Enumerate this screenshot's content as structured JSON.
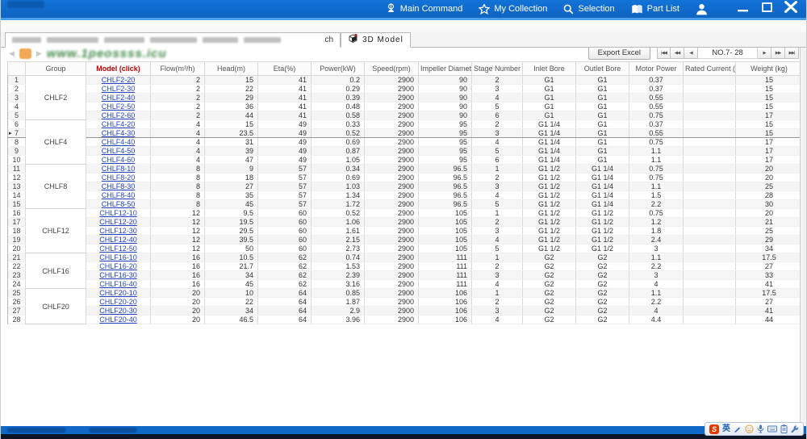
{
  "titlebar": {
    "menu": [
      {
        "label": "Main Command"
      },
      {
        "label": "My Collection"
      },
      {
        "label": "Selection"
      },
      {
        "label": "Part List"
      }
    ]
  },
  "tabs": {
    "redacted_tab_fragment": "ch",
    "model_tab_label": "3D Model"
  },
  "watermark": {
    "text": "www.1peossss.icu"
  },
  "toolbar": {
    "export_label": "Export Excel",
    "pager_prev": [
      "|◀◀",
      "◀◀",
      "◀"
    ],
    "page_label": "NO.7- 28",
    "pager_next": [
      "▶",
      "▶▶",
      "▶▶|"
    ]
  },
  "colors": {
    "titlebar_blue": "#0f67c6",
    "accent_blue": "#4d9ee9",
    "link_blue": "#2946c0",
    "model_header_red": "#c00000",
    "watermark_green": "#37813c",
    "ime_logo_red": "#e23b00"
  },
  "ime": {
    "logo": "S",
    "lang": "英",
    "icons": [
      "pen-icon",
      "smiley-icon",
      "mic-icon",
      "keyboard-icon",
      "clipboard-icon",
      "wrench-icon"
    ]
  },
  "table": {
    "headers": [
      "",
      "Group",
      "Model (click)",
      "Flow(m³/h)",
      "Head(m)",
      "Eta(%)",
      "Power(kW)",
      "Speed(rpm)",
      "Impeller Diameter",
      "Stage Number",
      "Inlet Bore",
      "Outlet Bore",
      "Motor Power",
      "Rated Current (A)",
      "Weight (kg)"
    ],
    "selected_row": 7,
    "groups": [
      {
        "name": "CHLF2",
        "rows": 5
      },
      {
        "name": "CHLF4",
        "rows": 5
      },
      {
        "name": "CHLF8",
        "rows": 5
      },
      {
        "name": "CHLF12",
        "rows": 5
      },
      {
        "name": "CHLF16",
        "rows": 4
      },
      {
        "name": "CHLF20",
        "rows": 4
      }
    ],
    "rows": [
      {
        "no": 1,
        "model": "CHLF2-20",
        "flow": 2,
        "head": 15,
        "eta": 41,
        "power": 0.2,
        "speed": 2900,
        "impeller": 90,
        "stage": 2,
        "inlet": "G1",
        "outlet": "G1",
        "motor": 0.37,
        "rated": "",
        "weight": 15
      },
      {
        "no": 2,
        "model": "CHLF2-30",
        "flow": 2,
        "head": 22,
        "eta": 41,
        "power": 0.29,
        "speed": 2900,
        "impeller": 90,
        "stage": 3,
        "inlet": "G1",
        "outlet": "G1",
        "motor": 0.37,
        "rated": "",
        "weight": 15
      },
      {
        "no": 3,
        "model": "CHLF2-40",
        "flow": 2,
        "head": 29,
        "eta": 41,
        "power": 0.39,
        "speed": 2900,
        "impeller": 90,
        "stage": 4,
        "inlet": "G1",
        "outlet": "G1",
        "motor": 0.55,
        "rated": "",
        "weight": 15
      },
      {
        "no": 4,
        "model": "CHLF2-50",
        "flow": 2,
        "head": 36,
        "eta": 41,
        "power": 0.48,
        "speed": 2900,
        "impeller": 90,
        "stage": 5,
        "inlet": "G1",
        "outlet": "G1",
        "motor": 0.55,
        "rated": "",
        "weight": 15
      },
      {
        "no": 5,
        "model": "CHLF2-60",
        "flow": 2,
        "head": 44,
        "eta": 41,
        "power": 0.58,
        "speed": 2900,
        "impeller": 90,
        "stage": 6,
        "inlet": "G1",
        "outlet": "G1",
        "motor": 0.75,
        "rated": "",
        "weight": 17
      },
      {
        "no": 6,
        "model": "CHLF4-20",
        "flow": 4,
        "head": 15,
        "eta": 49,
        "power": 0.33,
        "speed": 2900,
        "impeller": 95,
        "stage": 2,
        "inlet": "G1 1/4",
        "outlet": "G1",
        "motor": 0.37,
        "rated": "",
        "weight": 15
      },
      {
        "no": 7,
        "model": "CHLF4-30",
        "flow": 4,
        "head": 23.5,
        "eta": 49,
        "power": 0.52,
        "speed": 2900,
        "impeller": 95,
        "stage": 3,
        "inlet": "G1 1/4",
        "outlet": "G1",
        "motor": 0.55,
        "rated": "",
        "weight": 15
      },
      {
        "no": 8,
        "model": "CHLF4-40",
        "flow": 4,
        "head": 31,
        "eta": 49,
        "power": 0.69,
        "speed": 2900,
        "impeller": 95,
        "stage": 4,
        "inlet": "G1 1/4",
        "outlet": "G1",
        "motor": 0.75,
        "rated": "",
        "weight": 17
      },
      {
        "no": 9,
        "model": "CHLF4-50",
        "flow": 4,
        "head": 39,
        "eta": 49,
        "power": 0.87,
        "speed": 2900,
        "impeller": 95,
        "stage": 5,
        "inlet": "G1 1/4",
        "outlet": "G1",
        "motor": 1.1,
        "rated": "",
        "weight": 17
      },
      {
        "no": 10,
        "model": "CHLF4-60",
        "flow": 4,
        "head": 47,
        "eta": 49,
        "power": 1.05,
        "speed": 2900,
        "impeller": 95,
        "stage": 6,
        "inlet": "G1 1/4",
        "outlet": "G1",
        "motor": 1.1,
        "rated": "",
        "weight": 17
      },
      {
        "no": 11,
        "model": "CHLF8-10",
        "flow": 8,
        "head": 9,
        "eta": 57,
        "power": 0.34,
        "speed": 2900,
        "impeller": 96.5,
        "stage": 1,
        "inlet": "G1 1/2",
        "outlet": "G1 1/4",
        "motor": 0.75,
        "rated": "",
        "weight": 20
      },
      {
        "no": 12,
        "model": "CHLF8-20",
        "flow": 8,
        "head": 18,
        "eta": 57,
        "power": 0.69,
        "speed": 2900,
        "impeller": 96.5,
        "stage": 2,
        "inlet": "G1 1/2",
        "outlet": "G1 1/4",
        "motor": 0.75,
        "rated": "",
        "weight": 20
      },
      {
        "no": 13,
        "model": "CHLF8-30",
        "flow": 8,
        "head": 27,
        "eta": 57,
        "power": 1.03,
        "speed": 2900,
        "impeller": 96.5,
        "stage": 3,
        "inlet": "G1 1/2",
        "outlet": "G1 1/4",
        "motor": 1.1,
        "rated": "",
        "weight": 25
      },
      {
        "no": 14,
        "model": "CHLF8-40",
        "flow": 8,
        "head": 35,
        "eta": 57,
        "power": 1.34,
        "speed": 2900,
        "impeller": 96.5,
        "stage": 4,
        "inlet": "G1 1/2",
        "outlet": "G1 1/4",
        "motor": 1.5,
        "rated": "",
        "weight": 28
      },
      {
        "no": 15,
        "model": "CHLF8-50",
        "flow": 8,
        "head": 45,
        "eta": 57,
        "power": 1.72,
        "speed": 2900,
        "impeller": 96.5,
        "stage": 5,
        "inlet": "G1 1/2",
        "outlet": "G1 1/4",
        "motor": 2.2,
        "rated": "",
        "weight": 30
      },
      {
        "no": 16,
        "model": "CHLF12-10",
        "flow": 12,
        "head": 9.5,
        "eta": 60,
        "power": 0.52,
        "speed": 2900,
        "impeller": 105,
        "stage": 1,
        "inlet": "G1 1/2",
        "outlet": "G1 1/2",
        "motor": 0.75,
        "rated": "",
        "weight": 20
      },
      {
        "no": 17,
        "model": "CHLF12-20",
        "flow": 12,
        "head": 19.5,
        "eta": 60,
        "power": 1.06,
        "speed": 2900,
        "impeller": 105,
        "stage": 2,
        "inlet": "G1 1/2",
        "outlet": "G1 1/2",
        "motor": 1.2,
        "rated": "",
        "weight": 21
      },
      {
        "no": 18,
        "model": "CHLF12-30",
        "flow": 12,
        "head": 29.5,
        "eta": 60,
        "power": 1.61,
        "speed": 2900,
        "impeller": 105,
        "stage": 3,
        "inlet": "G1 1/2",
        "outlet": "G1 1/2",
        "motor": 1.8,
        "rated": "",
        "weight": 25
      },
      {
        "no": 19,
        "model": "CHLF12-40",
        "flow": 12,
        "head": 39.5,
        "eta": 60,
        "power": 2.15,
        "speed": 2900,
        "impeller": 105,
        "stage": 4,
        "inlet": "G1 1/2",
        "outlet": "G1 1/2",
        "motor": 2.4,
        "rated": "",
        "weight": 29
      },
      {
        "no": 20,
        "model": "CHLF12-50",
        "flow": 12,
        "head": 50,
        "eta": 60,
        "power": 2.73,
        "speed": 2900,
        "impeller": 105,
        "stage": 5,
        "inlet": "G1 1/2",
        "outlet": "G1 1/2",
        "motor": 3,
        "rated": "",
        "weight": 34
      },
      {
        "no": 21,
        "model": "CHLF16-10",
        "flow": 16,
        "head": 10.5,
        "eta": 62,
        "power": 0.74,
        "speed": 2900,
        "impeller": 111,
        "stage": 1,
        "inlet": "G2",
        "outlet": "G2",
        "motor": 1.1,
        "rated": "",
        "weight": 17.5
      },
      {
        "no": 22,
        "model": "CHLF16-20",
        "flow": 16,
        "head": 21.7,
        "eta": 62,
        "power": 1.53,
        "speed": 2900,
        "impeller": 111,
        "stage": 2,
        "inlet": "G2",
        "outlet": "G2",
        "motor": 2.2,
        "rated": "",
        "weight": 27
      },
      {
        "no": 23,
        "model": "CHLF16-30",
        "flow": 16,
        "head": 34,
        "eta": 62,
        "power": 2.39,
        "speed": 2900,
        "impeller": 111,
        "stage": 3,
        "inlet": "G2",
        "outlet": "G2",
        "motor": 3,
        "rated": "",
        "weight": 33
      },
      {
        "no": 24,
        "model": "CHLF16-40",
        "flow": 16,
        "head": 45,
        "eta": 62,
        "power": 3.16,
        "speed": 2900,
        "impeller": 111,
        "stage": 4,
        "inlet": "G2",
        "outlet": "G2",
        "motor": 4,
        "rated": "",
        "weight": 41
      },
      {
        "no": 25,
        "model": "CHLF20-10",
        "flow": 20,
        "head": 10,
        "eta": 64,
        "power": 0.85,
        "speed": 2900,
        "impeller": 106,
        "stage": 1,
        "inlet": "G2",
        "outlet": "G2",
        "motor": 1.1,
        "rated": "",
        "weight": 17.5
      },
      {
        "no": 26,
        "model": "CHLF20-20",
        "flow": 20,
        "head": 22,
        "eta": 64,
        "power": 1.87,
        "speed": 2900,
        "impeller": 106,
        "stage": 2,
        "inlet": "G2",
        "outlet": "G2",
        "motor": 2.2,
        "rated": "",
        "weight": 27
      },
      {
        "no": 27,
        "model": "CHLF20-30",
        "flow": 20,
        "head": 34,
        "eta": 64,
        "power": 2.9,
        "speed": 2900,
        "impeller": 106,
        "stage": 3,
        "inlet": "G2",
        "outlet": "G2",
        "motor": 4,
        "rated": "",
        "weight": 41
      },
      {
        "no": 28,
        "model": "CHLF20-40",
        "flow": 20,
        "head": 46.5,
        "eta": 64,
        "power": 3.96,
        "speed": 2900,
        "impeller": 106,
        "stage": 4,
        "inlet": "G2",
        "outlet": "G2",
        "motor": 4.4,
        "rated": "",
        "weight": 44
      }
    ]
  }
}
